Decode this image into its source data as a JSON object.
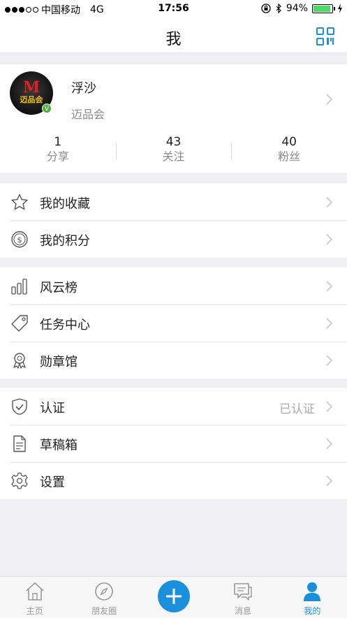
{
  "status_bar": {
    "carrier": "中国移动",
    "network": "4G",
    "time": "17:56",
    "battery": "94%"
  },
  "nav": {
    "title": "我"
  },
  "profile": {
    "username": "浮沙",
    "organization": "迈品会",
    "avatar_text": "M",
    "avatar_brand": "迈品会",
    "verified_mark": "V",
    "stats": [
      {
        "value": "1",
        "label": "分享"
      },
      {
        "value": "43",
        "label": "关注"
      },
      {
        "value": "40",
        "label": "粉丝"
      }
    ]
  },
  "menu": {
    "favorites": "我的收藏",
    "points": "我的积分",
    "ranking": "风云榜",
    "tasks": "任务中心",
    "badges": "勋章馆",
    "certification": "认证",
    "certification_status": "已认证",
    "drafts": "草稿箱",
    "settings": "设置"
  },
  "tab_bar": {
    "home": "主页",
    "friends": "朋友圈",
    "messages": "消息",
    "me": "我的"
  },
  "colors": {
    "accent": "#1a8fdc",
    "verified": "#52b043",
    "background": "#efeff4"
  },
  "icons": [
    "qr-code-icon",
    "star-icon",
    "coin-icon",
    "bar-chart-icon",
    "tag-icon",
    "medal-icon",
    "shield-check-icon",
    "document-icon",
    "gear-icon",
    "home-icon",
    "compass-icon",
    "plus-icon",
    "message-icon",
    "user-icon",
    "chevron-right-icon"
  ]
}
